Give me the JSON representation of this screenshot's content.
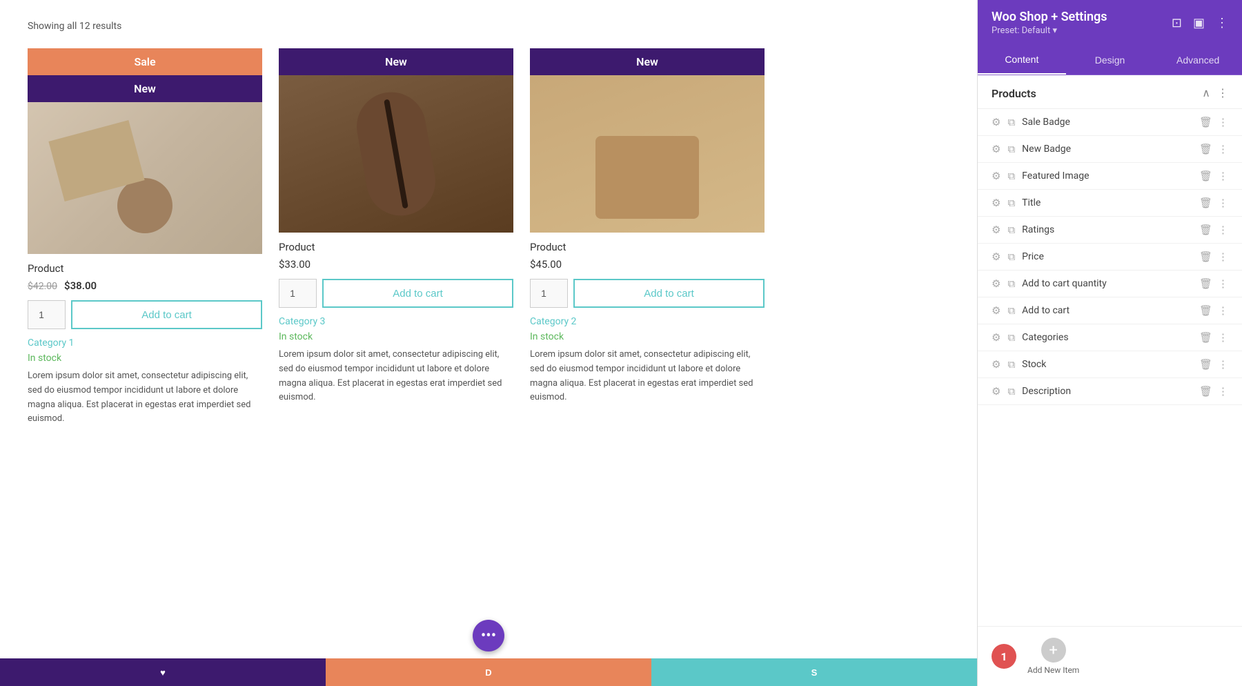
{
  "main": {
    "results_count": "Showing all 12 results",
    "products": [
      {
        "id": 1,
        "badge_sale": "Sale",
        "badge_new": "New",
        "name": "Product",
        "price_original": "$42.00",
        "price_sale": "$38.00",
        "qty": 1,
        "add_to_cart": "Add to cart",
        "category": "Category 1",
        "stock": "In stock",
        "description": "Lorem ipsum dolor sit amet, consectetur adipiscing elit, sed do eiusmod tempor incididunt ut labore et dolore magna aliqua. Est placerat in egestas erat imperdiet sed euismod."
      },
      {
        "id": 2,
        "badge_new": "New",
        "name": "Product",
        "price_regular": "$33.00",
        "qty": 1,
        "add_to_cart": "Add to cart",
        "category": "Category 3",
        "stock": "In stock",
        "description": "Lorem ipsum dolor sit amet, consectetur adipiscing elit, sed do eiusmod tempor incididunt ut labore et dolore magna aliqua. Est placerat in egestas erat imperdiet sed euismod."
      },
      {
        "id": 3,
        "badge_new": "New",
        "name": "Product",
        "price_regular": "$45.00",
        "qty": 1,
        "add_to_cart": "Add to cart",
        "category": "Category 2",
        "stock": "In stock",
        "description": "Lorem ipsum dolor sit amet, consectetur adipiscing elit, sed do eiusmod tempor incididunt ut labore et dolore magna aliqua. Est placerat in egestas erat imperdiet sed euismod."
      }
    ],
    "bottom_buttons": [
      "♥",
      "D",
      "S"
    ],
    "fab_icon": "•••"
  },
  "panel": {
    "title": "Woo Shop + Settings",
    "preset": "Preset: Default",
    "preset_arrow": "▾",
    "icons": {
      "screen": "⊡",
      "layout": "▣",
      "more": "⋮"
    },
    "tabs": [
      {
        "label": "Content",
        "active": true
      },
      {
        "label": "Design",
        "active": false
      },
      {
        "label": "Advanced",
        "active": false
      }
    ],
    "section": {
      "title": "Products",
      "collapse_icon": "∧",
      "more_icon": "⋮"
    },
    "items": [
      {
        "label": "Sale Badge"
      },
      {
        "label": "New Badge"
      },
      {
        "label": "Featured Image"
      },
      {
        "label": "Title"
      },
      {
        "label": "Ratings"
      },
      {
        "label": "Price"
      },
      {
        "label": "Add to cart quantity"
      },
      {
        "label": "Add to cart"
      },
      {
        "label": "Categories"
      },
      {
        "label": "Stock"
      },
      {
        "label": "Description"
      }
    ],
    "footer": {
      "badge_count": "1",
      "add_label": "Add New Item",
      "add_icon": "+"
    }
  }
}
